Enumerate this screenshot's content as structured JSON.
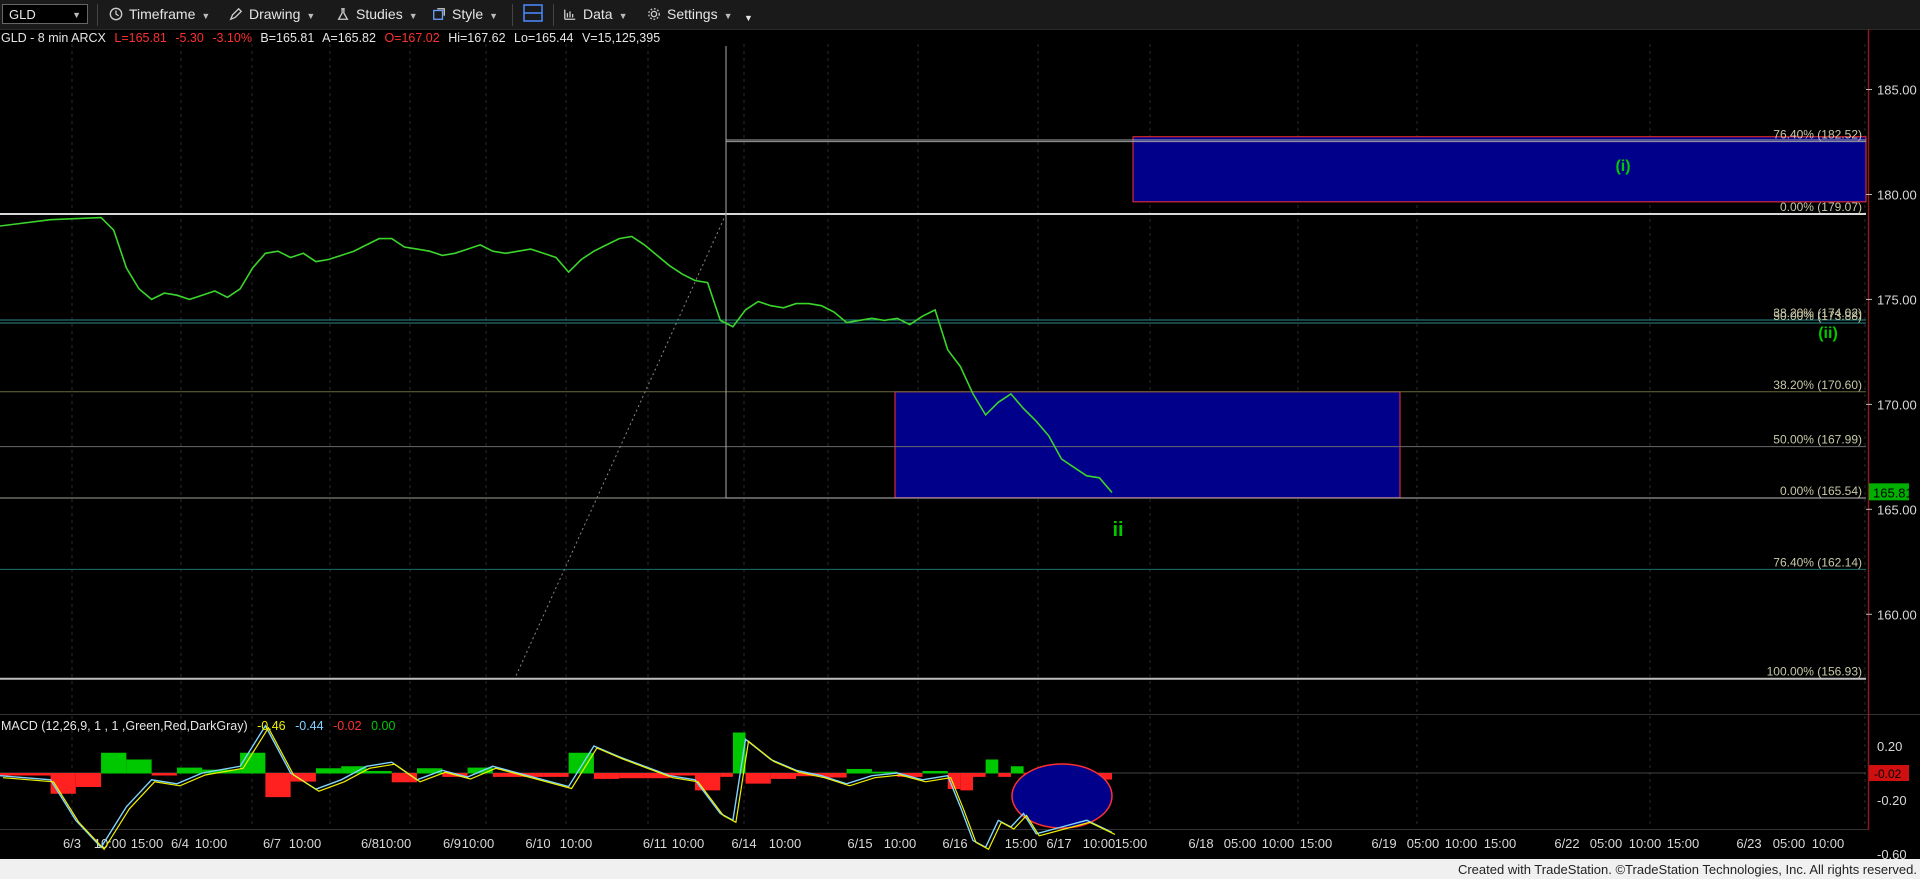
{
  "toolbar": {
    "symbol": "GLD",
    "timeframe": "Timeframe",
    "drawing": "Drawing",
    "studies": "Studies",
    "style": "Style",
    "data": "Data",
    "settings": "Settings"
  },
  "header": {
    "symbol_info": "GLD - 8 min  ARCX",
    "last": "L=165.81",
    "change": "-5.30",
    "change_pct": "-3.10%",
    "bid": "B=165.81",
    "ask": "A=165.82",
    "open": "O=167.02",
    "high": "Hi=167.62",
    "low": "Lo=165.44",
    "volume": "V=15,125,395"
  },
  "colors": {
    "price": "#3bd42b",
    "up": "#00c800",
    "down": "#ff2020",
    "accent_red": "#ff3030",
    "blue_box": "#00008b"
  },
  "chart_data": [
    {
      "type": "line",
      "title": "GLD - 8 min",
      "x_tick_labels": [
        "6/3",
        "10:00",
        "15:00",
        "6/4",
        "10:00",
        "6/7",
        "10:00",
        "6/8",
        "10:00",
        "6/9",
        "10:00",
        "6/10",
        "10:00",
        "6/11",
        "10:00",
        "6/14",
        "10:00",
        "6/15",
        "10:00",
        "6/16",
        "15:00",
        "6/17",
        "10:00",
        "15:00",
        "6/18",
        "05:00",
        "10:00",
        "15:00",
        "6/19",
        "05:00",
        "10:00",
        "15:00",
        "6/22",
        "05:00",
        "10:00",
        "15:00",
        "6/23",
        "05:00",
        "10:00"
      ],
      "y_ticks": [
        160.0,
        165.0,
        170.0,
        175.0,
        180.0,
        185.0
      ],
      "ylim": [
        156.5,
        188.5
      ],
      "last_price_label": "165.81",
      "price_series": [
        [
          0,
          178.5
        ],
        [
          4,
          178.8
        ],
        [
          8,
          178.9
        ],
        [
          9,
          178.3
        ],
        [
          10,
          176.5
        ],
        [
          11,
          175.5
        ],
        [
          12,
          175.0
        ],
        [
          13,
          175.3
        ],
        [
          14,
          175.2
        ],
        [
          15,
          175.0
        ],
        [
          16,
          175.2
        ],
        [
          17,
          175.4
        ],
        [
          18,
          175.1
        ],
        [
          19,
          175.5
        ],
        [
          20,
          176.5
        ],
        [
          21,
          177.2
        ],
        [
          22,
          177.3
        ],
        [
          23,
          177.0
        ],
        [
          24,
          177.2
        ],
        [
          25,
          176.8
        ],
        [
          26,
          176.9
        ],
        [
          27,
          177.1
        ],
        [
          28,
          177.3
        ],
        [
          29,
          177.6
        ],
        [
          30,
          177.9
        ],
        [
          31,
          177.9
        ],
        [
          32,
          177.5
        ],
        [
          33,
          177.4
        ],
        [
          34,
          177.3
        ],
        [
          35,
          177.1
        ],
        [
          36,
          177.2
        ],
        [
          37,
          177.4
        ],
        [
          38,
          177.6
        ],
        [
          39,
          177.3
        ],
        [
          40,
          177.2
        ],
        [
          41,
          177.3
        ],
        [
          42,
          177.4
        ],
        [
          43,
          177.2
        ],
        [
          44,
          177.0
        ],
        [
          45,
          176.3
        ],
        [
          46,
          176.9
        ],
        [
          47,
          177.3
        ],
        [
          48,
          177.6
        ],
        [
          49,
          177.9
        ],
        [
          50,
          178.0
        ],
        [
          51,
          177.6
        ],
        [
          52,
          177.1
        ],
        [
          53,
          176.6
        ],
        [
          54,
          176.2
        ],
        [
          55,
          175.9
        ],
        [
          56,
          175.8
        ],
        [
          57,
          174.0
        ],
        [
          58,
          173.7
        ],
        [
          59,
          174.5
        ],
        [
          60,
          174.9
        ],
        [
          61,
          174.7
        ],
        [
          62,
          174.6
        ],
        [
          63,
          174.8
        ],
        [
          64,
          174.8
        ],
        [
          65,
          174.7
        ],
        [
          66,
          174.4
        ],
        [
          67,
          173.9
        ],
        [
          68,
          174.0
        ],
        [
          69,
          174.1
        ],
        [
          70,
          174.0
        ],
        [
          71,
          174.1
        ],
        [
          72,
          173.8
        ],
        [
          73,
          174.2
        ],
        [
          74,
          174.5
        ],
        [
          75,
          172.6
        ],
        [
          76,
          171.8
        ],
        [
          77,
          170.5
        ],
        [
          78,
          169.5
        ],
        [
          79,
          170.1
        ],
        [
          80,
          170.5
        ],
        [
          81,
          169.8
        ],
        [
          82,
          169.2
        ],
        [
          83,
          168.5
        ],
        [
          84,
          167.4
        ],
        [
          85,
          167.0
        ],
        [
          86,
          166.6
        ],
        [
          87,
          166.5
        ],
        [
          88,
          165.8
        ]
      ],
      "price_x_range": [
        0,
        88
      ],
      "horizontal_levels": [
        {
          "price": 182.52,
          "label": "76.40% (182.52)",
          "color": "#a0a0a0"
        },
        {
          "price": 179.07,
          "label": "0.00% (179.07)",
          "color": "#d8d8d8"
        },
        {
          "price": 174.02,
          "label": "38.20% (174.02)",
          "color": "#2a8a8a"
        },
        {
          "price": 173.88,
          "label": "50.00% (173.88)",
          "color": "#2a8a8a"
        },
        {
          "price": 170.6,
          "label": "38.20% (170.60)",
          "color": "#6a6a3a"
        },
        {
          "price": 167.99,
          "label": "50.00% (167.99)",
          "color": "#6a6a6a"
        },
        {
          "price": 165.54,
          "label": "0.00% (165.54)",
          "color": "#a0a090"
        },
        {
          "price": 162.14,
          "label": "76.40% (162.14)",
          "color": "#1e6e6e"
        },
        {
          "price": 156.93,
          "label": "100.00% (156.93)",
          "color": "#bdbdbd"
        }
      ],
      "zones": [
        {
          "from": 179.65,
          "to": 182.75,
          "label": "(i)"
        },
        {
          "from": 165.55,
          "to": 170.6,
          "label": ""
        }
      ],
      "wave_labels": [
        "(i)",
        "(ii)",
        "ii"
      ]
    },
    {
      "type": "line",
      "title": "MACD (12,26,9, 1 , 1 ,Green,Red,DarkGray)",
      "legend_values": [
        "-0.46",
        "-0.44",
        "-0.02",
        "0.00"
      ],
      "y_ticks": [
        0.2,
        -0.2,
        -0.6
      ],
      "ylim": [
        -0.85,
        0.45
      ],
      "current_label": "-0.02",
      "macd_series": [
        [
          0,
          -0.02
        ],
        [
          4,
          -0.05
        ],
        [
          6,
          -0.35
        ],
        [
          8,
          -0.55
        ],
        [
          10,
          -0.25
        ],
        [
          12,
          -0.05
        ],
        [
          14,
          -0.08
        ],
        [
          16,
          0.0
        ],
        [
          19,
          0.05
        ],
        [
          21,
          0.35
        ],
        [
          23,
          0.0
        ],
        [
          25,
          -0.12
        ],
        [
          27,
          -0.05
        ],
        [
          29,
          0.05
        ],
        [
          31,
          0.08
        ],
        [
          33,
          -0.05
        ],
        [
          35,
          0.02
        ],
        [
          37,
          -0.03
        ],
        [
          39,
          0.05
        ],
        [
          41,
          0.0
        ],
        [
          43,
          -0.05
        ],
        [
          45,
          -0.1
        ],
        [
          47,
          0.2
        ],
        [
          49,
          0.12
        ],
        [
          51,
          0.05
        ],
        [
          53,
          -0.02
        ],
        [
          55,
          -0.05
        ],
        [
          57,
          -0.3
        ],
        [
          58,
          -0.35
        ],
        [
          59,
          0.25
        ],
        [
          61,
          0.1
        ],
        [
          63,
          0.02
        ],
        [
          65,
          -0.02
        ],
        [
          67,
          -0.08
        ],
        [
          69,
          -0.02
        ],
        [
          71,
          0.0
        ],
        [
          73,
          -0.05
        ],
        [
          75,
          -0.02
        ],
        [
          76,
          -0.25
        ],
        [
          77,
          -0.5
        ],
        [
          78,
          -0.55
        ],
        [
          79,
          -0.35
        ],
        [
          80,
          -0.4
        ],
        [
          81,
          -0.3
        ],
        [
          82,
          -0.45
        ],
        [
          84,
          -0.4
        ],
        [
          86,
          -0.35
        ],
        [
          88,
          -0.44
        ]
      ]
    }
  ],
  "footer": "Created with TradeStation. ©TradeStation Technologies, Inc. All rights reserved."
}
